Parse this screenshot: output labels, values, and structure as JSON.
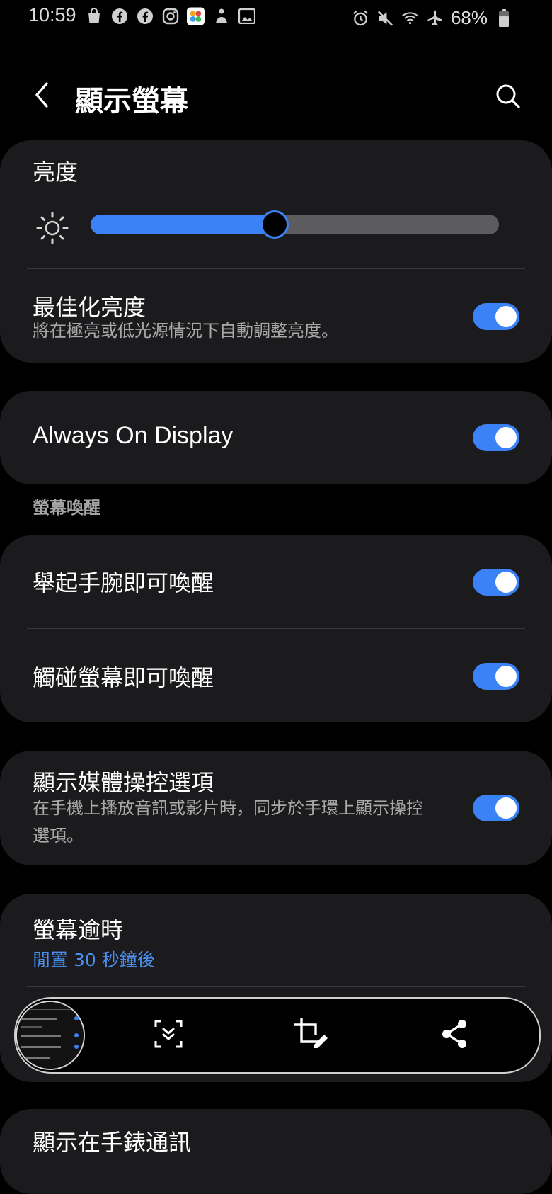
{
  "status_bar": {
    "time": "10:59",
    "battery_percent": "68%"
  },
  "header": {
    "title": "顯示螢幕"
  },
  "brightness": {
    "label": "亮度",
    "level": 0.45
  },
  "adaptive_brightness": {
    "title": "最佳化亮度",
    "subtitle": "將在極亮或低光源情況下自動調整亮度。",
    "enabled": true
  },
  "always_on_display": {
    "title": "Always On Display",
    "enabled": true
  },
  "wake_section": {
    "header": "螢幕喚醒",
    "items": [
      {
        "title": "舉起手腕即可喚醒",
        "enabled": true
      },
      {
        "title": "觸碰螢幕即可喚醒",
        "enabled": true
      }
    ]
  },
  "media_controls": {
    "title": "顯示媒體操控選項",
    "subtitle": "在手機上播放音訊或影片時，同步於手環上顯示操控選項。",
    "enabled": true
  },
  "screen_timeout": {
    "title": "螢幕逾時",
    "value": "閒置 30 秒鐘後"
  },
  "next_item": {
    "title": "顯示在手錶通訊"
  },
  "colors": {
    "accent": "#3b82f6",
    "card_bg": "#1b1b1d",
    "link": "#4b8ff0"
  }
}
